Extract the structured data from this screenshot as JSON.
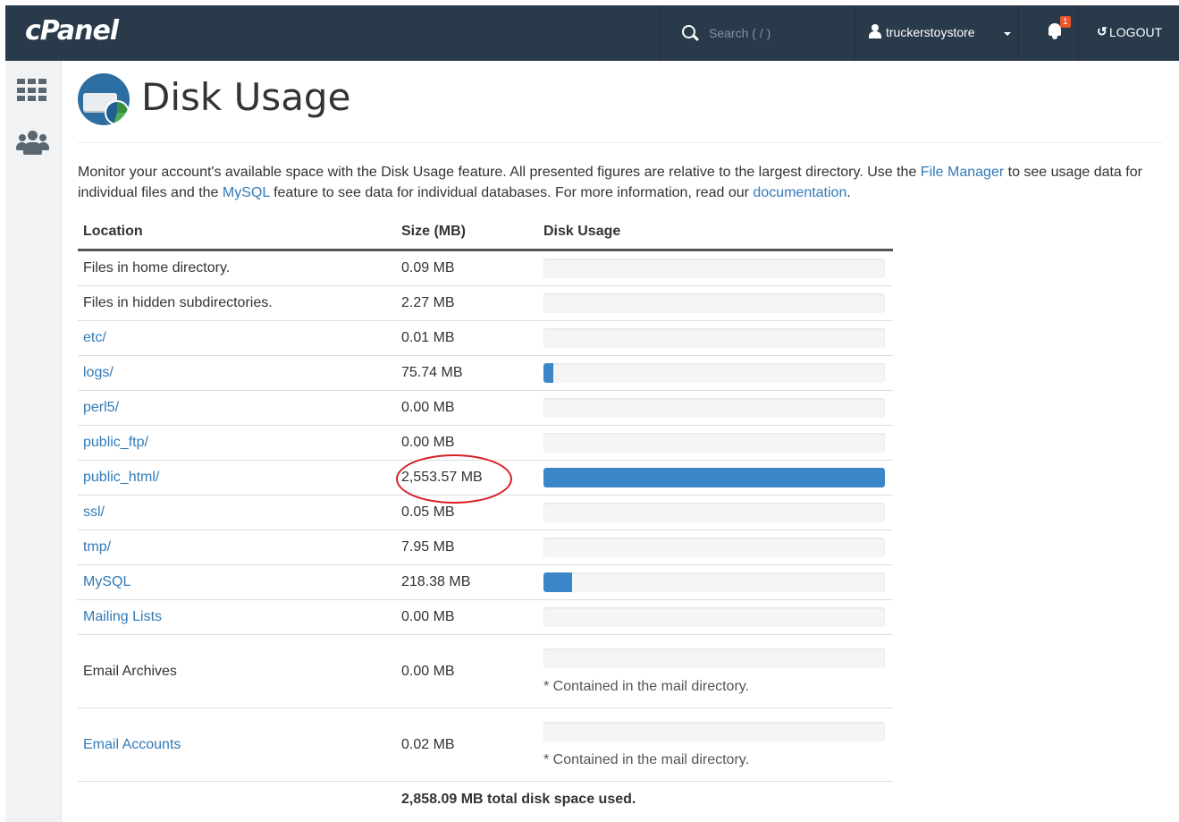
{
  "header": {
    "logo": "cPanel",
    "search": {
      "placeholder": "Search ( / )",
      "value": ""
    },
    "user": {
      "name": "truckerstoystore"
    },
    "notifications": {
      "count": "1"
    },
    "logout": {
      "label": "LOGOUT"
    }
  },
  "sidebar": {
    "items": [
      {
        "icon": "grid-icon"
      },
      {
        "icon": "users-icon"
      }
    ]
  },
  "page": {
    "title": "Disk Usage",
    "intro": {
      "part1": "Monitor your account's available space with the Disk Usage feature. All presented figures are relative to the largest directory. Use the ",
      "link_file_manager": "File Manager",
      "part2": " to see usage data for individual files and the ",
      "link_mysql": "MySQL",
      "part3": " feature to see data for individual databases. For more information, read our ",
      "link_documentation": "documentation",
      "part4": "."
    }
  },
  "table": {
    "headers": {
      "location": "Location",
      "size": "Size (MB)",
      "usage": "Disk Usage"
    },
    "rows": [
      {
        "location": "Files in home directory.",
        "link": false,
        "size": "0.09 MB",
        "fraction": 0.0,
        "note": ""
      },
      {
        "location": "Files in hidden subdirectories.",
        "link": false,
        "size": "2.27 MB",
        "fraction": 0.0,
        "note": ""
      },
      {
        "location": "etc/",
        "link": true,
        "size": "0.01 MB",
        "fraction": 0.0,
        "note": ""
      },
      {
        "location": "logs/",
        "link": true,
        "size": "75.74 MB",
        "fraction": 0.03,
        "note": ""
      },
      {
        "location": "perl5/",
        "link": true,
        "size": "0.00 MB",
        "fraction": 0.0,
        "note": ""
      },
      {
        "location": "public_ftp/",
        "link": true,
        "size": "0.00 MB",
        "fraction": 0.0,
        "note": ""
      },
      {
        "location": "public_html/",
        "link": true,
        "size": "2,553.57 MB",
        "fraction": 1.0,
        "note": ""
      },
      {
        "location": "ssl/",
        "link": true,
        "size": "0.05 MB",
        "fraction": 0.0,
        "note": ""
      },
      {
        "location": "tmp/",
        "link": true,
        "size": "7.95 MB",
        "fraction": 0.0,
        "note": ""
      },
      {
        "location": "MySQL",
        "link": true,
        "size": "218.38 MB",
        "fraction": 0.085,
        "note": ""
      },
      {
        "location": "Mailing Lists",
        "link": true,
        "size": "0.00 MB",
        "fraction": 0.0,
        "note": ""
      },
      {
        "location": "Email Archives",
        "link": false,
        "size": "0.00 MB",
        "fraction": 0.0,
        "note": "* Contained in the mail directory."
      },
      {
        "location": "Email Accounts",
        "link": true,
        "size": "0.02 MB",
        "fraction": 0.0,
        "note": "* Contained in the mail directory."
      }
    ],
    "total": "2,858.09 MB total disk space used."
  },
  "colors": {
    "topbar": "#293a4a",
    "link": "#337ab7",
    "bar": "#3b86c8",
    "annotation": "#d81d24"
  }
}
